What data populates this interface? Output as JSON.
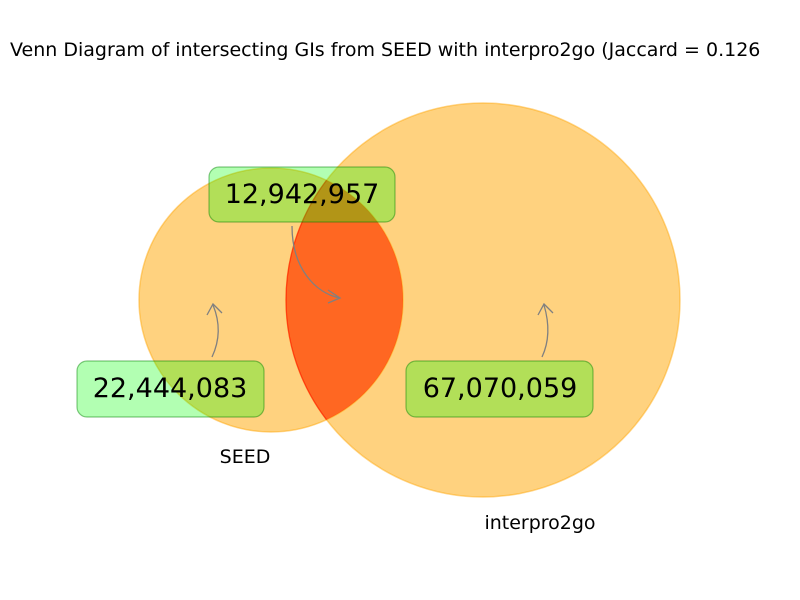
{
  "title": "Venn Diagram of intersecting GIs from SEED with interpro2go (Jaccard = 0.126",
  "chart_data": {
    "type": "venn",
    "title": "Venn Diagram of intersecting GIs from SEED with interpro2go (Jaccard = 0.126",
    "sets": [
      {
        "name": "SEED",
        "only_count": "22,444,083",
        "color": "#FFA500"
      },
      {
        "name": "interpro2go",
        "only_count": "67,070,059",
        "color": "#FFA500"
      }
    ],
    "intersection": {
      "count": "12,942,957",
      "color": "#FF0000"
    },
    "colors": {
      "circle_fill": "#FFA500",
      "circle_stroke": "#FFA500",
      "overlap_fill": "#FF0000",
      "label_box_fill": "#00FF00",
      "label_box_stroke": "#008000",
      "arrow": "#808080"
    }
  }
}
